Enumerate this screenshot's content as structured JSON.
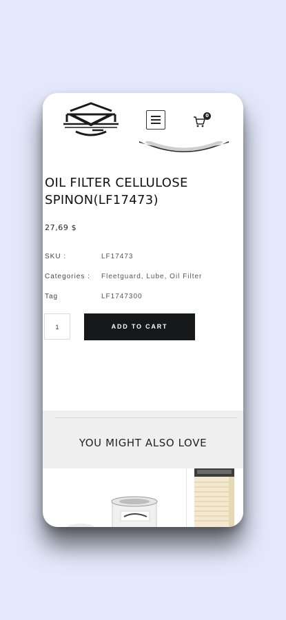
{
  "header": {
    "logo_name": "logo",
    "menu_icon": "hamburger-menu-icon",
    "cart_icon": "cart-icon",
    "cart_count": "0"
  },
  "product": {
    "title_line1": "OIL FILTER CELLULOSE",
    "title_line2": "SPINON(LF17473)",
    "price": "27,69 $",
    "meta": [
      {
        "key": "SKU :",
        "value": "LF17473"
      },
      {
        "key": "Categories :",
        "value": "Fleetguard, Lube, Oil Filter"
      },
      {
        "key": "Tag",
        "value": "LF1747300"
      }
    ],
    "quantity": "1",
    "add_to_cart_label": "ADD TO CART"
  },
  "related": {
    "title": "YOU MIGHT ALSO LOVE"
  },
  "colors": {
    "page_background": "#e3e9fb",
    "button": "#17181a",
    "section_background": "#efefef"
  }
}
